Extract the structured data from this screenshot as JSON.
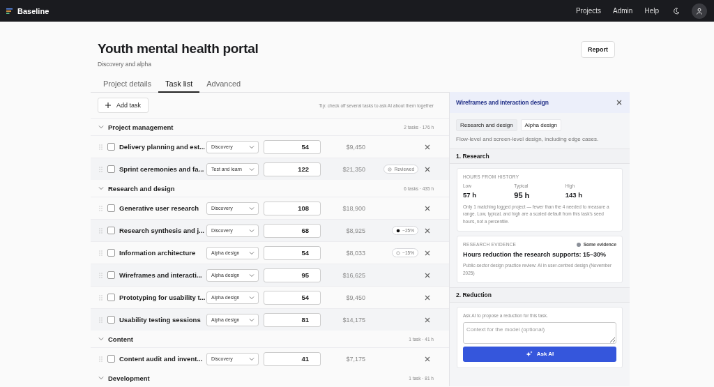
{
  "app": {
    "name": "Baseline"
  },
  "nav": [
    "Projects",
    "Admin",
    "Help"
  ],
  "project": {
    "title": "Youth mental health portal",
    "subtitle": "Discovery and alpha",
    "report_button": "Report"
  },
  "tabs": [
    {
      "label": "Project details",
      "selected": false
    },
    {
      "label": "Task list",
      "selected": true
    },
    {
      "label": "Advanced",
      "selected": false
    }
  ],
  "toolbar": {
    "add_button": "Add task",
    "tip": "Tip: check off several tasks to ask AI about them together"
  },
  "groups": [
    {
      "name": "Project management",
      "summary": "2 tasks · 176 h",
      "expanded": true,
      "tasks": [
        {
          "name": "Delivery planning and est...",
          "phase": "Discovery",
          "hours": "54",
          "cost": "$9,450",
          "checked": false
        },
        {
          "name": "Sprint ceremonies and fa...",
          "phase": "Test and learn",
          "hours": "122",
          "cost": "$21,350",
          "checked": false,
          "badge": {
            "kind": "reviewed",
            "text": "Reviewed"
          }
        }
      ]
    },
    {
      "name": "Research and design",
      "summary": "6 tasks · 435 h",
      "expanded": true,
      "tasks": [
        {
          "name": "Generative user research",
          "phase": "Discovery",
          "hours": "108",
          "cost": "$18,900",
          "checked": false
        },
        {
          "name": "Research synthesis and j...",
          "phase": "Discovery",
          "hours": "68",
          "cost": "$8,925",
          "checked": false,
          "badge": {
            "kind": "filled",
            "text": "−25%"
          }
        },
        {
          "name": "Information architecture",
          "phase": "Alpha design",
          "hours": "54",
          "cost": "$8,033",
          "checked": false,
          "badge": {
            "kind": "outline",
            "text": "−15%"
          }
        },
        {
          "name": "Wireframes and interacti...",
          "phase": "Alpha design",
          "hours": "95",
          "cost": "$16,625",
          "checked": false
        },
        {
          "name": "Prototyping for usability t...",
          "phase": "Alpha design",
          "hours": "54",
          "cost": "$9,450",
          "checked": false
        },
        {
          "name": "Usability testing sessions",
          "phase": "Alpha design",
          "hours": "81",
          "cost": "$14,175",
          "checked": false
        }
      ]
    },
    {
      "name": "Content",
      "summary": "1 task · 41 h",
      "expanded": true,
      "tasks": [
        {
          "name": "Content audit and invent...",
          "phase": "Discovery",
          "hours": "41",
          "cost": "$7,175",
          "checked": false
        }
      ]
    },
    {
      "name": "Development",
      "summary": "1 task · 81 h",
      "expanded": true
    }
  ],
  "panel": {
    "title": "Wireframes and interaction design",
    "tags": [
      "Research and design",
      "Alpha design"
    ],
    "description": "Flow-level and screen-level design, including edge cases.",
    "research": {
      "heading": "1. Research",
      "history": {
        "label": "HOURS FROM HISTORY",
        "stats": [
          {
            "label": "Low",
            "value": "57 h",
            "emphasis": false
          },
          {
            "label": "Typical",
            "value": "95 h",
            "emphasis": true
          },
          {
            "label": "High",
            "value": "143 h",
            "emphasis": false
          }
        ],
        "note": "Only 1 matching logged project — fewer than the 4 needed to measure a range. Low, typical, and high are a scaled default from this task's seed hours, not a percentile."
      },
      "evidence": {
        "label": "RESEARCH EVIDENCE",
        "status": {
          "text": "Some evidence",
          "color": "#8a8f98"
        },
        "headline": "Hours reduction the research supports: 15–30%",
        "source": "Public-sector design practice review: AI in user-centred design (November 2025)"
      }
    },
    "reduction": {
      "heading": "2. Reduction",
      "prompt": "Ask AI to propose a reduction for this task.",
      "placeholder": "Context for the model (optional)",
      "button": "Ask AI"
    }
  }
}
